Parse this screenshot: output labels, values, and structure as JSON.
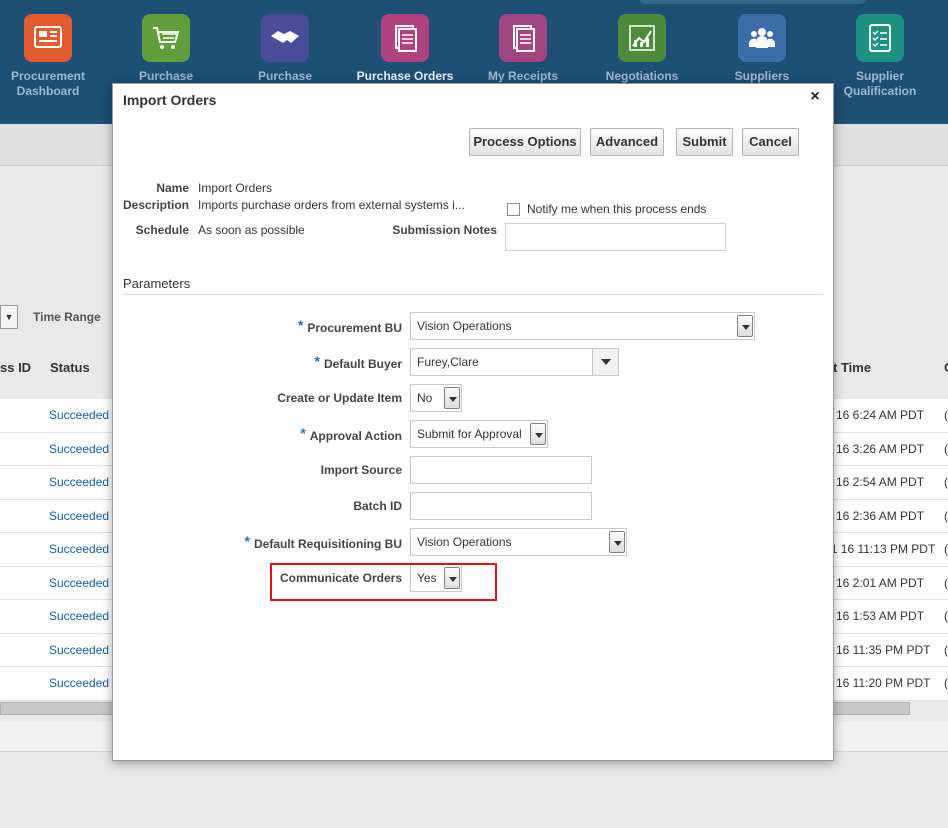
{
  "nav": {
    "items": [
      {
        "label": "Procurement Dashboard",
        "icon": "dashboard-icon",
        "color": "#e35b2e"
      },
      {
        "label": "Purchase",
        "icon": "shopping-cart-icon",
        "color": "#5f9e3a"
      },
      {
        "label": "Purchase",
        "icon": "handshake-icon",
        "color": "#4a4e9a"
      },
      {
        "label": "Purchase Orders",
        "icon": "documents-icon",
        "color": "#b0437f"
      },
      {
        "label": "My Receipts",
        "icon": "receipt-icon",
        "color": "#a0457e"
      },
      {
        "label": "Negotiations",
        "icon": "negotiation-chart-icon",
        "color": "#4d8a3a"
      },
      {
        "label": "Suppliers",
        "icon": "people-icon",
        "color": "#3b6ea8"
      },
      {
        "label": "Supplier Qualification",
        "icon": "checklist-icon",
        "color": "#1e9281"
      }
    ],
    "active_index": 3
  },
  "background": {
    "time_range_label": "Time Range",
    "columns": {
      "process_id": "ss ID",
      "status": "Status",
      "time": "t Time",
      "edge": "C"
    },
    "rows": [
      {
        "status": "Succeeded",
        "time": "16 6:24 AM PDT",
        "edge": "("
      },
      {
        "status": "Succeeded",
        "time": "16 3:26 AM PDT",
        "edge": "("
      },
      {
        "status": "Succeeded",
        "time": "16 2:54 AM PDT",
        "edge": "("
      },
      {
        "status": "Succeeded",
        "time": "16 2:36 AM PDT",
        "edge": "("
      },
      {
        "status": "Succeeded",
        "time": "11 16 11:13 PM PDT",
        "edge": "("
      },
      {
        "status": "Succeeded",
        "time": "16 2:01 AM PDT",
        "edge": "("
      },
      {
        "status": "Succeeded",
        "time": "16 1:53 AM PDT",
        "edge": "("
      },
      {
        "status": "Succeeded",
        "time": "16 11:35 PM PDT",
        "edge": "("
      },
      {
        "status": "Succeeded",
        "time": "16 11:20 PM PDT",
        "edge": "("
      }
    ]
  },
  "dialog": {
    "title": "Import Orders",
    "close_symbol": "×",
    "buttons": {
      "process_options": "Process Options",
      "advanced": "Advanced",
      "submit": "Submit",
      "cancel": "Cancel"
    },
    "info": {
      "name_label": "Name",
      "name_value": "Import Orders",
      "description_label": "Description",
      "description_value": "Imports purchase orders from external systems i...",
      "schedule_label": "Schedule",
      "schedule_value": "As soon as possible",
      "notify_label": "Notify me when this process ends",
      "notify_checked": false,
      "submission_notes_label": "Submission Notes",
      "submission_notes_value": ""
    },
    "parameters": {
      "section_label": "Parameters",
      "procurement_bu": {
        "label": "Procurement BU",
        "value": "Vision Operations",
        "required": true
      },
      "default_buyer": {
        "label": "Default Buyer",
        "value": "Furey,Clare",
        "required": true
      },
      "create_or_update_item": {
        "label": "Create or Update Item",
        "value": "No",
        "required": false
      },
      "approval_action": {
        "label": "Approval Action",
        "value": "Submit for Approval",
        "required": true
      },
      "import_source": {
        "label": "Import Source",
        "value": "",
        "required": false
      },
      "batch_id": {
        "label": "Batch ID",
        "value": "",
        "required": false
      },
      "default_requisitioning_bu": {
        "label": "Default Requisitioning BU",
        "value": "Vision Operations",
        "required": true
      },
      "communicate_orders": {
        "label": "Communicate Orders",
        "value": "Yes",
        "required": false
      }
    },
    "required_marker": "*",
    "highlight_color": "#e0121a"
  }
}
